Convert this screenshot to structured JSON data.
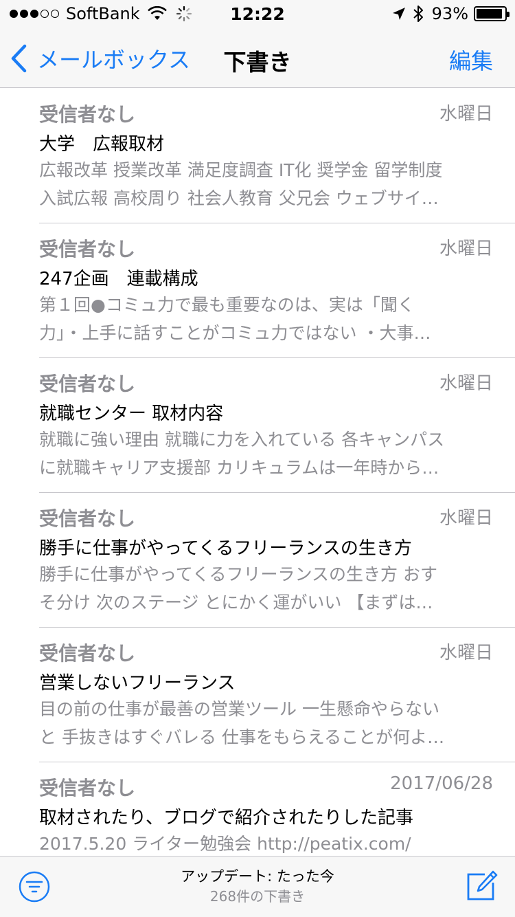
{
  "status_bar": {
    "signal_dots": [
      true,
      true,
      true,
      false,
      false
    ],
    "carrier": "SoftBank",
    "time": "12:22",
    "battery_percent": "93%",
    "battery_level": 0.93,
    "icons": [
      "wifi-icon",
      "activity-spinner-icon",
      "location-arrow-icon",
      "bluetooth-icon",
      "battery-icon"
    ]
  },
  "nav": {
    "back_label": "メールボックス",
    "title": "下書き",
    "edit_label": "編集",
    "accent_color": "#1a7cf5"
  },
  "mails": [
    {
      "sender": "受信者なし",
      "date": "水曜日",
      "subject": "大学　広報取材",
      "preview_lines": [
        "広報改革 授業改革 満足度調査 IT化 奨学金 留学制度",
        "入試広報 高校周り 社会人教育 父兄会 ウェブサイ…"
      ]
    },
    {
      "sender": "受信者なし",
      "date": "水曜日",
      "subject": "247企画　連載構成",
      "preview_lines": [
        "第１回●コミュ力で最も重要なのは、実は「聞く",
        "力」・上手に話すことがコミュ力ではない ・大事…"
      ]
    },
    {
      "sender": "受信者なし",
      "date": "水曜日",
      "subject": "就職センター 取材内容",
      "preview_lines": [
        "就職に強い理由 就職に力を入れている 各キャンパス",
        "に就職キャリア支援部 カリキュラムは一年時から…"
      ]
    },
    {
      "sender": "受信者なし",
      "date": "水曜日",
      "subject": "勝手に仕事がやってくるフリーランスの生き方",
      "preview_lines": [
        "勝手に仕事がやってくるフリーランスの生き方 おす",
        "そ分け 次のステージ とにかく運がいい 【まずは…"
      ]
    },
    {
      "sender": "受信者なし",
      "date": "水曜日",
      "subject": "営業しないフリーランス",
      "preview_lines": [
        "目の前の仕事が最善の営業ツール 一生懸命やらない",
        "と 手抜きはすぐバレる 仕事をもらえることが何よ…"
      ]
    },
    {
      "sender": "受信者なし",
      "date": "2017/06/28",
      "subject": "取材されたり、ブログで紹介されたりした記事",
      "preview_lines": [
        "2017.5.20 ライター勉強会 http://peatix.com/",
        ""
      ]
    }
  ],
  "toolbar": {
    "update_status": "アップデート: たった今",
    "draft_count": "268件の下書き",
    "filter_icon": "filter-icon",
    "compose_icon": "compose-icon"
  }
}
